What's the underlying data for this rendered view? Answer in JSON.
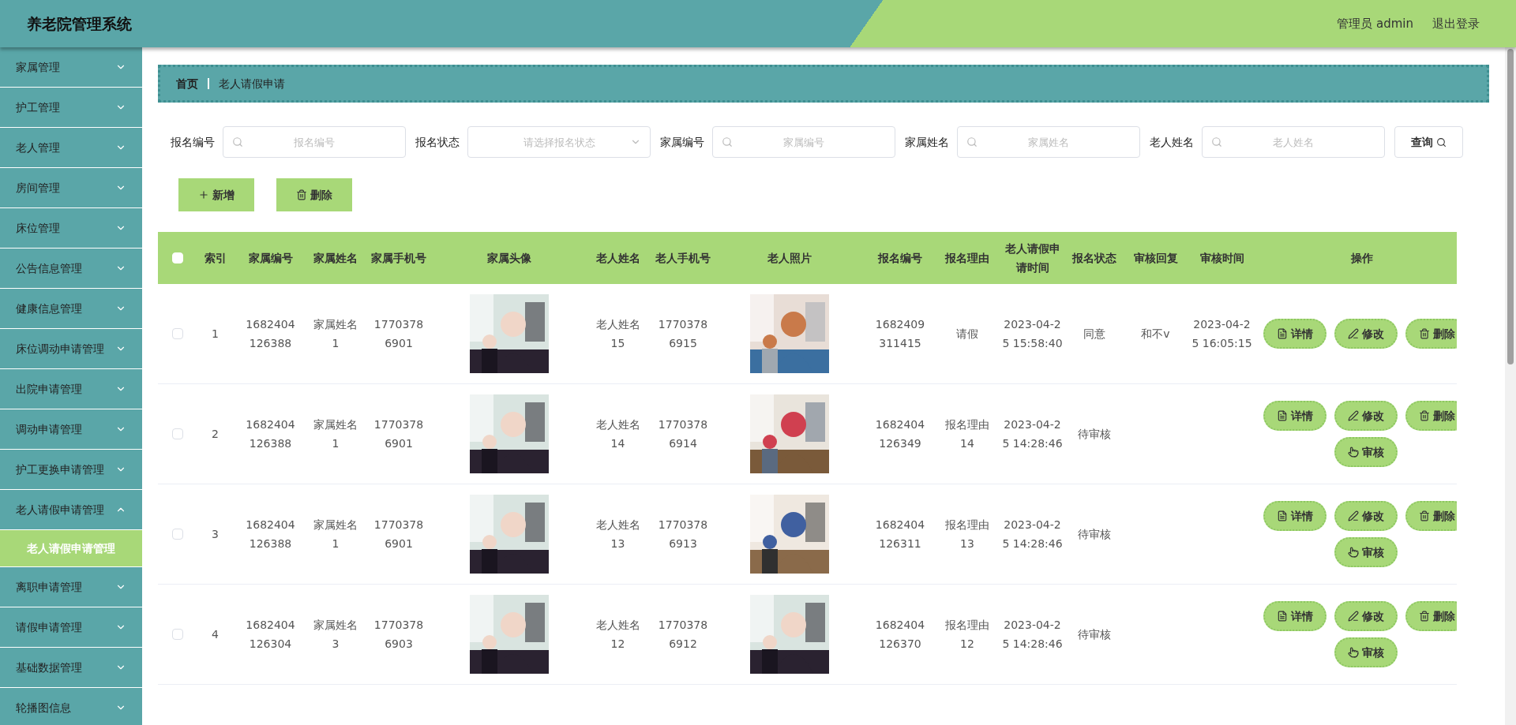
{
  "header": {
    "title": "养老院管理系统",
    "user": "管理员 admin",
    "logout": "退出登录"
  },
  "sidebar": {
    "items": [
      {
        "label": "家属管理",
        "expanded": false
      },
      {
        "label": "护工管理",
        "expanded": false
      },
      {
        "label": "老人管理",
        "expanded": false
      },
      {
        "label": "房间管理",
        "expanded": false
      },
      {
        "label": "床位管理",
        "expanded": false
      },
      {
        "label": "公告信息管理",
        "expanded": false
      },
      {
        "label": "健康信息管理",
        "expanded": false
      },
      {
        "label": "床位调动申请管理",
        "expanded": false
      },
      {
        "label": "出院申请管理",
        "expanded": false
      },
      {
        "label": "调动申请管理",
        "expanded": false
      },
      {
        "label": "护工更换申请管理",
        "expanded": false
      },
      {
        "label": "老人请假申请管理",
        "expanded": true,
        "children": [
          {
            "label": "老人请假申请管理",
            "selected": true
          }
        ]
      },
      {
        "label": "离职申请管理",
        "expanded": false
      },
      {
        "label": "请假申请管理",
        "expanded": false
      },
      {
        "label": "基础数据管理",
        "expanded": false
      },
      {
        "label": "轮播图信息",
        "expanded": false
      }
    ]
  },
  "breadcrumb": [
    "首页",
    "老人请假申请"
  ],
  "filters": [
    {
      "kind": "text",
      "label": "报名编号",
      "placeholder": "报名编号"
    },
    {
      "kind": "select",
      "label": "报名状态",
      "placeholder": "请选择报名状态"
    },
    {
      "kind": "text",
      "label": "家属编号",
      "placeholder": "家属编号"
    },
    {
      "kind": "text",
      "label": "家属姓名",
      "placeholder": "家属姓名"
    },
    {
      "kind": "text",
      "label": "老人姓名",
      "placeholder": "老人姓名"
    }
  ],
  "search_button": "查询",
  "toolbar": [
    {
      "kind": "add",
      "label": "新增"
    },
    {
      "kind": "delete",
      "label": "删除"
    }
  ],
  "table": {
    "columns": [
      "索引",
      "家属编号",
      "家属姓名",
      "家属手机号",
      "家属头像",
      "老人姓名",
      "老人手机号",
      "老人照片",
      "报名编号",
      "报名理由",
      "老人请假申请时间",
      "报名状态",
      "审核回复",
      "审核时间",
      "操作"
    ],
    "select_all": {
      "checked": false
    },
    "rows": [
      {
        "checked": false,
        "index": "1",
        "family_no": "1682404126388",
        "family_name": "家属姓名1",
        "family_phone": "17703786901",
        "family_avatar": {
          "kind": "picture"
        },
        "elder_name": "老人姓名15",
        "elder_phone": "17703786915",
        "elder_photo": {
          "kind": "picture"
        },
        "apply_no": "1682409311415",
        "reason": "请假",
        "apply_time": "2023-04-25 15:58:40",
        "status": "同意",
        "reply": "和不v",
        "review_time": "2023-04-25 16:05:15",
        "actions": [
          {
            "kind": "detail",
            "label": "详情"
          },
          {
            "kind": "edit",
            "label": "修改"
          },
          {
            "kind": "delete",
            "label": "删除"
          }
        ]
      },
      {
        "checked": false,
        "index": "2",
        "family_no": "1682404126388",
        "family_name": "家属姓名1",
        "family_phone": "17703786901",
        "family_avatar": {
          "kind": "picture"
        },
        "elder_name": "老人姓名14",
        "elder_phone": "17703786914",
        "elder_photo": {
          "kind": "picture"
        },
        "apply_no": "1682404126349",
        "reason": "报名理由14",
        "apply_time": "2023-04-25 14:28:46",
        "status": "待审核",
        "actions": [
          {
            "kind": "detail",
            "label": "详情"
          },
          {
            "kind": "edit",
            "label": "修改"
          },
          {
            "kind": "delete",
            "label": "删除"
          },
          {
            "kind": "review",
            "label": "审核"
          }
        ]
      },
      {
        "checked": false,
        "index": "3",
        "family_no": "1682404126388",
        "family_name": "家属姓名1",
        "family_phone": "17703786901",
        "family_avatar": {
          "kind": "picture"
        },
        "elder_name": "老人姓名13",
        "elder_phone": "17703786913",
        "elder_photo": {
          "kind": "picture"
        },
        "apply_no": "1682404126311",
        "reason": "报名理由13",
        "apply_time": "2023-04-25 14:28:46",
        "status": "待审核",
        "actions": [
          {
            "kind": "detail",
            "label": "详情"
          },
          {
            "kind": "edit",
            "label": "修改"
          },
          {
            "kind": "delete",
            "label": "删除"
          },
          {
            "kind": "review",
            "label": "审核"
          }
        ]
      },
      {
        "checked": false,
        "index": "4",
        "family_no": "1682404126304",
        "family_name": "家属姓名3",
        "family_phone": "17703786903",
        "family_avatar": {
          "kind": "picture"
        },
        "elder_name": "老人姓名12",
        "elder_phone": "17703786912",
        "elder_photo": {
          "kind": "picture"
        },
        "apply_no": "1682404126370",
        "reason": "报名理由12",
        "apply_time": "2023-04-25 14:28:46",
        "status": "待审核",
        "actions": [
          {
            "kind": "detail",
            "label": "详情"
          },
          {
            "kind": "edit",
            "label": "修改"
          },
          {
            "kind": "delete",
            "label": "删除"
          },
          {
            "kind": "review",
            "label": "审核"
          }
        ]
      }
    ]
  }
}
